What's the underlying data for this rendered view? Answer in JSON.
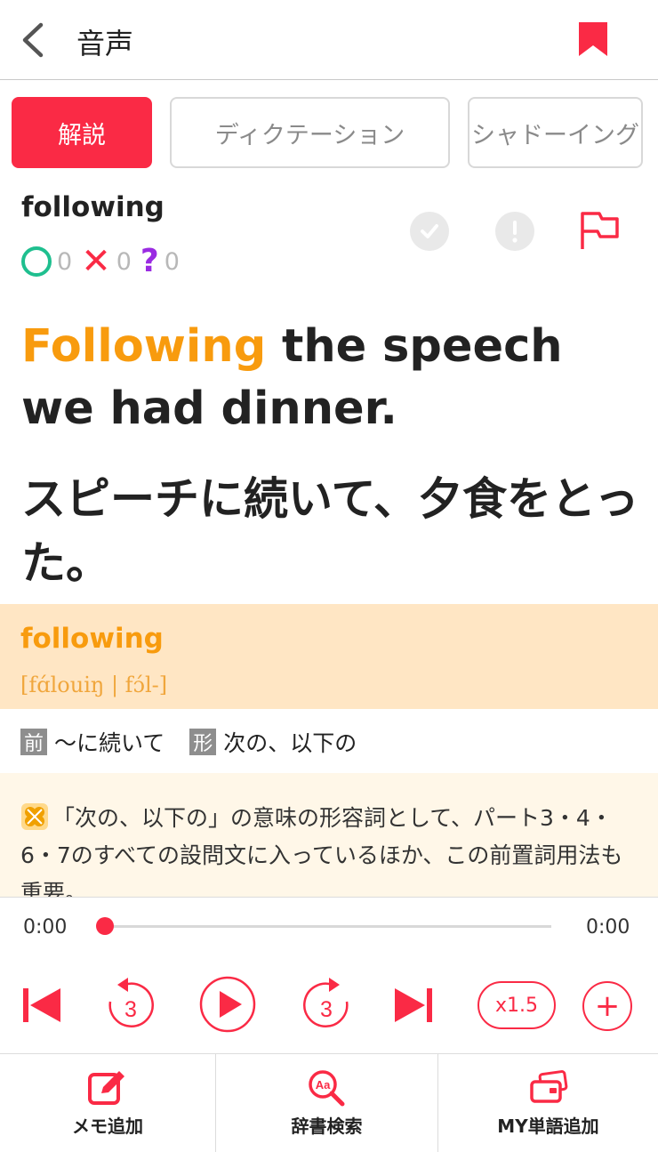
{
  "header": {
    "title": "音声"
  },
  "tabs": [
    {
      "label": "解説",
      "active": true
    },
    {
      "label": "ディクテーション",
      "active": false
    },
    {
      "label": "シャドーイング",
      "active": false
    }
  ],
  "word": {
    "headword": "following",
    "scores": {
      "correct": "0",
      "wrong": "0",
      "unsure": "0"
    }
  },
  "sentence": {
    "highlight": "Following",
    "rest": " the speech we had dinner.",
    "translation": "スピーチに続いて、夕食をとった。"
  },
  "dictionary": {
    "word": "following",
    "pronunciation": "[fɑ́louiŋ | fɔ́l-]",
    "definitions": [
      {
        "pos": "前",
        "meaning": "〜に続いて"
      },
      {
        "pos": "形",
        "meaning": "次の、以下の"
      }
    ],
    "note": "「次の、以下の」の意味の形容詞として、パート3・4・6・7のすべての設問文に入っているほか、この前置詞用法も重要。"
  },
  "player": {
    "current_time": "0:00",
    "total_time": "0:00",
    "progress": 0,
    "skip_back_seconds": "3",
    "skip_forward_seconds": "3",
    "speed": "x1.5",
    "add_label": "+"
  },
  "toolbar": {
    "memo": "メモ追加",
    "dict": "辞書検索",
    "my_word": "MY単語追加"
  },
  "colors": {
    "accent": "#fa2a45",
    "highlight": "#f89b0e",
    "correct": "#1fbf8f",
    "unsure": "#9a2be2"
  }
}
